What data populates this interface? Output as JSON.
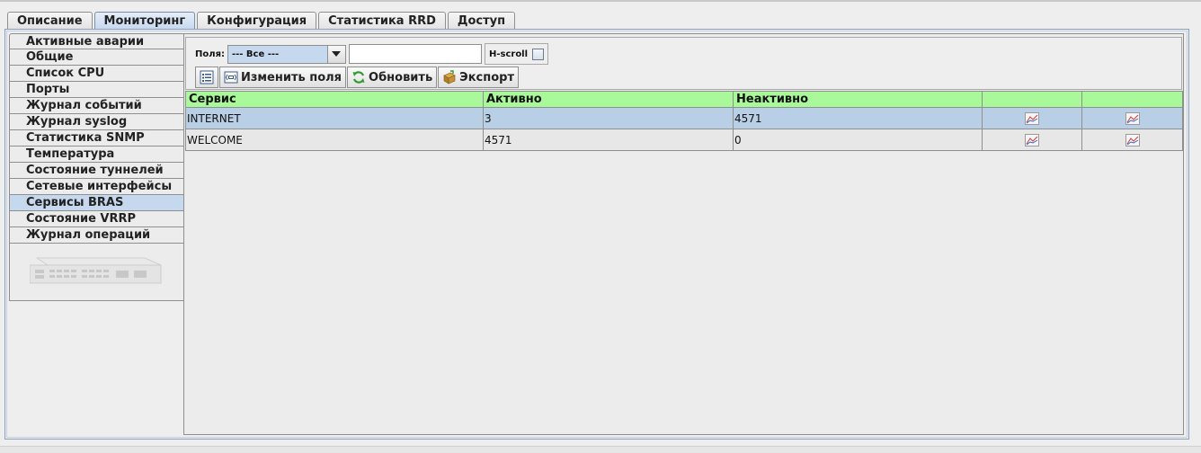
{
  "tabs": [
    "Описание",
    "Мониторинг",
    "Конфигурация",
    "Статистика RRD",
    "Доступ"
  ],
  "active_tab": 1,
  "side_menu": [
    "Активные аварии",
    "Общие",
    "Список CPU",
    "Порты",
    "Журнал событий",
    "Журнал syslog",
    "Статистика SNMP",
    "Температура",
    "Состояние туннелей",
    "Сетевые интерфейсы",
    "Сервисы BRAS",
    "Состояние VRRP",
    "Журнал операций"
  ],
  "active_side_item": 10,
  "toolbar": {
    "fields_label": "Поля:",
    "fields_value": "--- Все ---",
    "search_value": "",
    "hscroll_label": "H-scroll",
    "hscroll_checked": false,
    "edit_fields_label": "Изменить поля",
    "refresh_label": "Обновить",
    "export_label": "Экспорт"
  },
  "table": {
    "columns": [
      "Сервис",
      "Активно",
      "Неактивно",
      "",
      ""
    ],
    "rows": [
      {
        "service": "INTERNET",
        "active": "3",
        "inactive": "4571",
        "selected": true
      },
      {
        "service": "WELCOME",
        "active": "4571",
        "inactive": "0",
        "selected": false
      }
    ]
  },
  "colors": {
    "header_bg": "#a9f89a",
    "selected_row": "#b8cfe5",
    "active_tab": "#c6d8ee"
  },
  "icons": {
    "combo_arrow": "chevron-down-icon",
    "columns_button": "column-list-icon",
    "edit_fields": "edit-fields-icon",
    "refresh": "refresh-icon",
    "export": "export-icon",
    "row_chart": "chart-icon",
    "device": "network-switch-icon"
  }
}
